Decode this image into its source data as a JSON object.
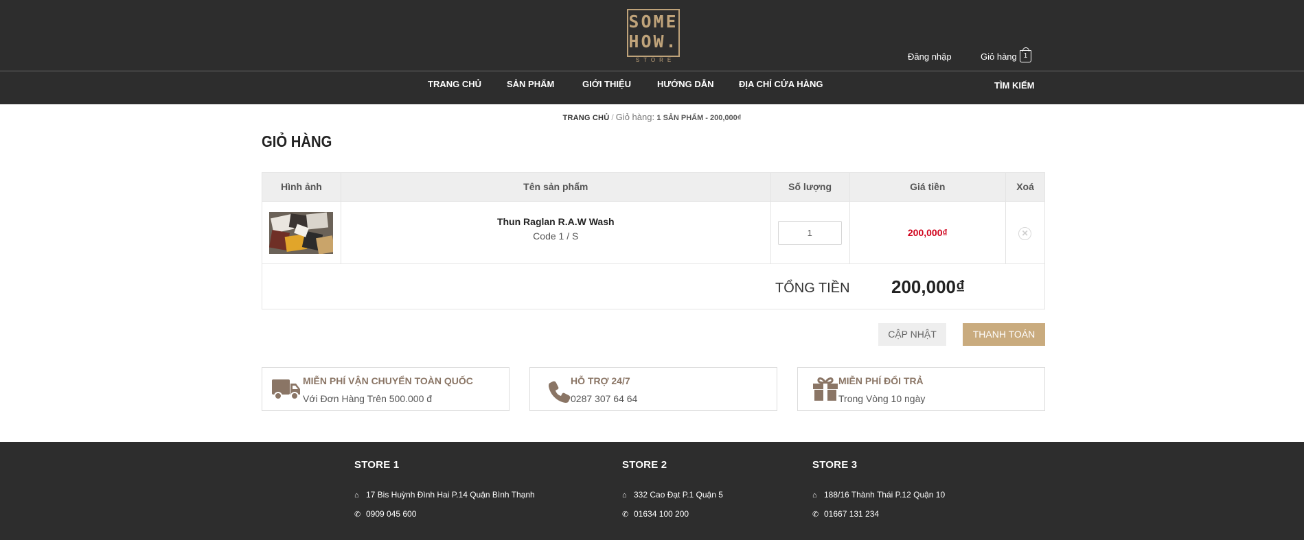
{
  "logo": {
    "line1": "SOME",
    "line2": "HOW.",
    "sub": "STORE"
  },
  "header": {
    "login": "Đăng nhập",
    "cart": "Giỏ hàng",
    "cart_count": "1"
  },
  "nav": {
    "items": [
      "TRANG CHỦ",
      "SẢN PHẨM",
      "GIỚI THIỆU",
      "HƯỚNG DẪN",
      "ĐỊA CHỈ CỬA HÀNG"
    ],
    "search": "TÌM KIẾM"
  },
  "breadcrumb": {
    "home": "TRANG CHỦ",
    "sep": "/",
    "current": "Giỏ hàng:",
    "count": "1 SẢN PHẨM - 200,000₫"
  },
  "page_title": "GIỎ HÀNG",
  "table": {
    "headers": [
      "Hình ảnh",
      "Tên sản phẩm",
      "Số lượng",
      "Giá tiền",
      "Xoá"
    ],
    "rows": [
      {
        "name": "Thun Raglan R.A.W Wash",
        "variant": "Code 1 / S",
        "quantity": "1",
        "price": "200,000₫"
      }
    ],
    "total_label": "TỔNG TIỀN",
    "total_value": "200,000₫"
  },
  "buttons": {
    "update": "CẬP NHẬT",
    "checkout": "THANH TOÁN"
  },
  "features": [
    {
      "icon": "truck-icon",
      "title": "MIỄN PHÍ VẬN CHUYỂN TOÀN QUỐC",
      "desc": "Với Đơn Hàng Trên 500.000 đ"
    },
    {
      "icon": "phone-icon",
      "title": "HỖ TRỢ 24/7",
      "desc": "0287 307 64 64"
    },
    {
      "icon": "gift-icon",
      "title": "MIỄN PHÍ ĐỔI TRẢ",
      "desc": "Trong Vòng 10 ngày"
    }
  ],
  "stores": [
    {
      "title": "STORE 1",
      "address": "17 Bis Huỳnh Đình Hai P.14 Quận Bình Thạnh",
      "phone": "0909 045 600"
    },
    {
      "title": "STORE 2",
      "address": "332 Cao Đạt P.1 Quận 5",
      "phone": "01634 100 200"
    },
    {
      "title": "STORE 3",
      "address": "188/16 Thành Thái P.12 Quận 10",
      "phone": "01667 131 234"
    }
  ],
  "colors": {
    "header_bg": "#2d2d2d",
    "accent": "#c9ab7e",
    "price": "#d0021b",
    "feature_title": "#8a7565"
  }
}
